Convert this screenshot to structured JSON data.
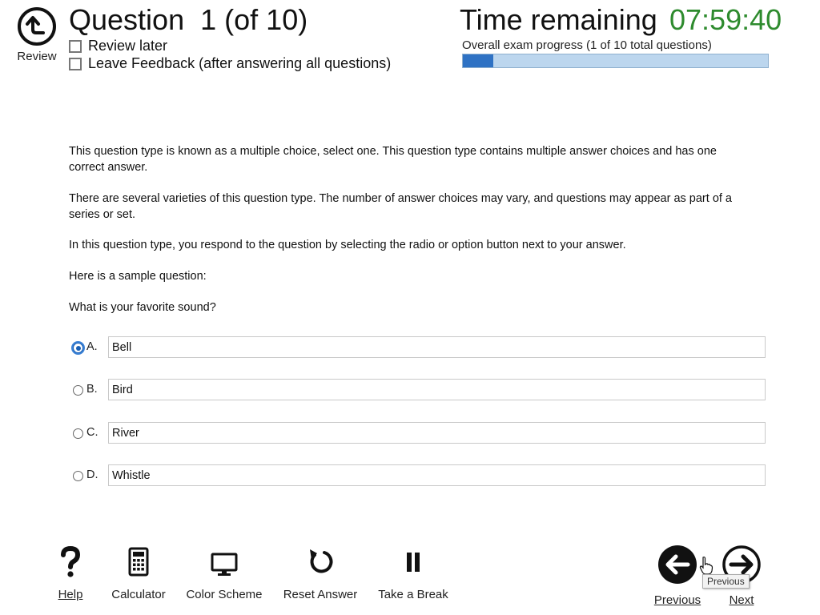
{
  "header": {
    "review_label": "Review",
    "question_word": "Question",
    "question_number": "1",
    "question_of": "(of 10)",
    "review_later_label": "Review later",
    "feedback_label": "Leave Feedback (after answering all questions)",
    "time_remaining_label": "Time remaining",
    "time_remaining_value": "07:59:40",
    "progress_label": "Overall exam progress (1 of 10 total questions)",
    "progress_fraction": 0.1,
    "colors": {
      "timer": "#2e8b2e",
      "progress_fill": "#2f72c4",
      "progress_track": "#bcd6ee"
    }
  },
  "question": {
    "paragraphs": [
      "This question type is known as a multiple choice, select one. This question type contains multiple answer choices and has one correct answer.",
      "There are several varieties of this question type. The number of answer choices may vary, and questions may appear as part of a series or set.",
      "In this question type, you respond to the question by selecting the radio or option button next to your answer.",
      "Here is a sample question:",
      "What is your favorite sound?"
    ],
    "options": [
      {
        "letter": "A.",
        "text": "Bell",
        "selected": true
      },
      {
        "letter": "B.",
        "text": "Bird",
        "selected": false
      },
      {
        "letter": "C.",
        "text": "River",
        "selected": false
      },
      {
        "letter": "D.",
        "text": "Whistle",
        "selected": false
      }
    ]
  },
  "footer": {
    "tools": [
      {
        "label": "Help",
        "icon": "question-mark-icon"
      },
      {
        "label": "Calculator",
        "icon": "calculator-icon"
      },
      {
        "label": "Color Scheme",
        "icon": "monitor-icon"
      },
      {
        "label": "Reset Answer",
        "icon": "reset-icon"
      },
      {
        "label": "Take a Break",
        "icon": "pause-icon"
      }
    ],
    "previous_label": "Previous",
    "next_label": "Next",
    "tooltip": "Previous"
  }
}
